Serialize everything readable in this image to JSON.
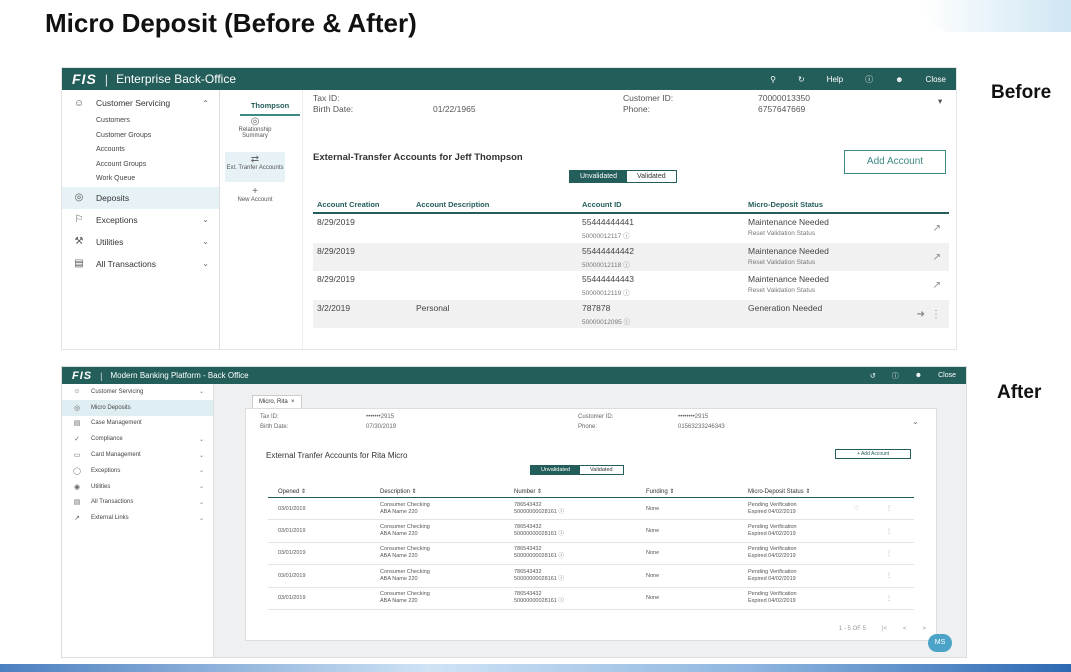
{
  "slide": {
    "title": "Micro Deposit (Before & After)",
    "before_label": "Before",
    "after_label": "After"
  },
  "before": {
    "logo": "FIS",
    "app_title": "Enterprise Back-Office",
    "toolbar": {
      "help": "Help",
      "close": "Close"
    },
    "nav": {
      "customer_servicing": "Customer Servicing",
      "sub_items": [
        "Customers",
        "Customer Groups",
        "Accounts",
        "Account Groups",
        "Work Queue"
      ],
      "deposits": "Deposits",
      "exceptions": "Exceptions",
      "utilities": "Utilities",
      "all_transactions": "All Transactions"
    },
    "customer_tab": "Thompson",
    "vtabs": {
      "relationship": "Relationship Summary",
      "ext_transfer": "Ext. Tranfer Accounts",
      "new_account": "New Account"
    },
    "info": {
      "tax_id_label": "Tax ID:",
      "birth_date_label": "Birth Date:",
      "birth_date": "01/22/1965",
      "customer_id_label": "Customer ID:",
      "customer_id": "70000013350",
      "phone_label": "Phone:",
      "phone": "6757647669"
    },
    "section_title": "External-Transfer Accounts for Jeff Thompson",
    "add_account": "Add Account",
    "toggle": {
      "unvalidated": "Unvalidated",
      "validated": "Validated"
    },
    "columns": [
      "Account Creation",
      "Account Description",
      "Account ID",
      "Micro-Deposit Status"
    ],
    "rows": [
      {
        "created": "8/29/2019",
        "desc": "",
        "id": "55444444441",
        "sub_id": "50000012117 ⓘ",
        "status": "Maintenance Needed",
        "sub_status": "Reset Validation Status"
      },
      {
        "created": "8/29/2019",
        "desc": "",
        "id": "55444444442",
        "sub_id": "50000012118 ⓘ",
        "status": "Maintenance Needed",
        "sub_status": "Reset Validation Status"
      },
      {
        "created": "8/29/2019",
        "desc": "",
        "id": "55444444443",
        "sub_id": "50000012119 ⓘ",
        "status": "Maintenance Needed",
        "sub_status": "Reset Validation Status"
      },
      {
        "created": "3/2/2019",
        "desc": "Personal",
        "id": "787878",
        "sub_id": "50000012095 ⓘ",
        "status": "Generation Needed",
        "sub_status": ""
      }
    ]
  },
  "after": {
    "logo": "FIS",
    "app_title": "Modern Banking Platform - Back Office",
    "toolbar": {
      "close": "Close"
    },
    "nav": [
      "Customer Servicing",
      "Micro Deposits",
      "Case Management",
      "Compliance",
      "Card Management",
      "Exceptions",
      "Utilities",
      "All Transactions",
      "External Links"
    ],
    "customer_tab": "Micro, Rita",
    "info": {
      "tax_id_label": "Tax ID:",
      "tax_id": "•••••••2915",
      "birth_date_label": "Birth Date:",
      "birth_date": "07/30/2019",
      "customer_id_label": "Customer ID:",
      "customer_id": "••••••••2915",
      "phone_label": "Phone:",
      "phone": "01563233246343"
    },
    "section_title": "External Tranfer Accounts for Rita Micro",
    "add_account": "+ Add Account",
    "toggle": {
      "unvalidated": "Unvalidated",
      "validated": "Validated"
    },
    "columns": [
      "Opened ⇕",
      "Description ⇕",
      "Number ⇕",
      "Funding ⇕",
      "Micro-Deposit Status ⇕"
    ],
    "rows": [
      {
        "opened": "03/01/2019",
        "desc1": "Consumer Checking",
        "desc2": "ABA Name 220",
        "num1": "786543432",
        "num2": "50000000028161 ⓘ",
        "funding": "None",
        "status1": "Pending Verification",
        "status2": "Expired 04/02/2019"
      },
      {
        "opened": "03/01/2019",
        "desc1": "Consumer Checking",
        "desc2": "ABA Name 220",
        "num1": "786543432",
        "num2": "50000000028161 ⓘ",
        "funding": "None",
        "status1": "Pending Verification",
        "status2": "Expired 04/02/2019"
      },
      {
        "opened": "03/01/2019",
        "desc1": "Consumer Checking",
        "desc2": "ABA Name 220",
        "num1": "786543432",
        "num2": "50000000028161 ⓘ",
        "funding": "None",
        "status1": "Pending Verification",
        "status2": "Expired 04/02/2019"
      },
      {
        "opened": "03/01/2019",
        "desc1": "Consumer Checking",
        "desc2": "ABA Name 220",
        "num1": "786543432",
        "num2": "50000000028161 ⓘ",
        "funding": "None",
        "status1": "Pending Verification",
        "status2": "Expired 04/02/2019"
      },
      {
        "opened": "03/01/2019",
        "desc1": "Consumer Checking",
        "desc2": "ABA Name 220",
        "num1": "786543432",
        "num2": "50000000028161 ⓘ",
        "funding": "None",
        "status1": "Pending Verification",
        "status2": "Expired 04/02/2019"
      }
    ],
    "pager_text": "1 - 5 OF 5",
    "avatar": "MS"
  }
}
